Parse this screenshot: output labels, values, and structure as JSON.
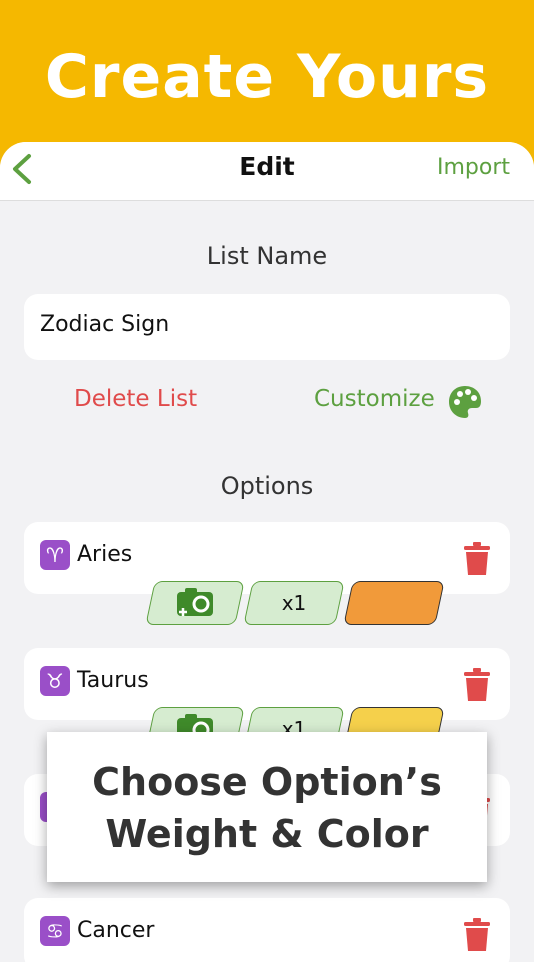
{
  "banner": {
    "title": "Create Yours"
  },
  "navbar": {
    "title": "Edit",
    "import_label": "Import"
  },
  "list_name": {
    "label": "List Name",
    "value": "Zodiac Sign"
  },
  "actions": {
    "delete_label": "Delete List",
    "customize_label": "Customize"
  },
  "options": {
    "label": "Options",
    "items": [
      {
        "symbol": "♈",
        "label": "Aries",
        "weight": "x1",
        "color": "#f19a3a"
      },
      {
        "symbol": "♉",
        "label": "Taurus",
        "weight": "x1",
        "color": "#f5d04b"
      },
      {
        "symbol": "♋",
        "label": "Cancer"
      }
    ]
  },
  "caption": {
    "line1": "Choose Option’s",
    "line2": "Weight & Color"
  },
  "colors": {
    "accent_green": "#5da040",
    "danger_red": "#e04b4b",
    "banner_yellow": "#f5b800"
  }
}
